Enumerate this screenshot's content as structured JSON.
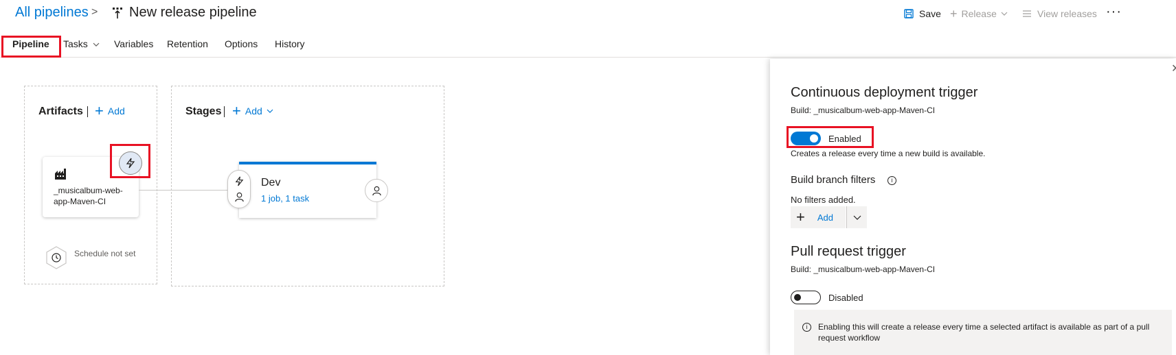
{
  "header": {
    "breadcrumb_link": "All pipelines",
    "breadcrumb_sep": ">",
    "title": "New release pipeline",
    "save_label": "Save",
    "release_label": "Release",
    "view_releases_label": "View releases",
    "more_label": "···"
  },
  "tabs": {
    "pipeline": "Pipeline",
    "tasks": "Tasks",
    "variables": "Variables",
    "retention": "Retention",
    "options": "Options",
    "history": "History"
  },
  "artifacts": {
    "title": "Artifacts",
    "add_label": "Add",
    "card_name": "_musicalbum-web-app-Maven-CI",
    "schedule_text": "Schedule not set"
  },
  "stages": {
    "title": "Stages",
    "add_label": "Add",
    "stage_name": "Dev",
    "stage_summary": "1 job, 1 task"
  },
  "panel": {
    "cd_title": "Continuous deployment trigger",
    "cd_build": "Build: _musicalbum-web-app-Maven-CI",
    "cd_state": "Enabled",
    "cd_help": "Creates a release every time a new build is available.",
    "filters_title": "Build branch filters",
    "filters_empty": "No filters added.",
    "filters_add": "Add",
    "pr_title": "Pull request trigger",
    "pr_build": "Build: _musicalbum-web-app-Maven-CI",
    "pr_state": "Disabled",
    "pr_info": "Enabling this will create a release every time a selected artifact is available as part of a pull request workflow"
  },
  "colors": {
    "accent": "#0078d4",
    "highlight": "#e81123"
  }
}
